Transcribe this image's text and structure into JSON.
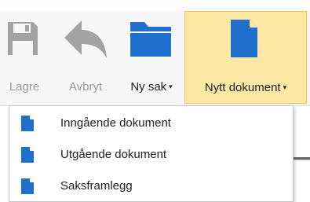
{
  "toolbar": {
    "buttons": [
      {
        "label": "Lagre",
        "icon": "floppy-disk-icon",
        "enabled": false
      },
      {
        "label": "Avbryt",
        "icon": "undo-arrow-icon",
        "enabled": false
      },
      {
        "label": "Ny sak",
        "icon": "folder-icon",
        "enabled": true,
        "has_dropdown": true
      },
      {
        "label": "Nytt dokument",
        "icon": "document-icon",
        "enabled": true,
        "has_dropdown": true,
        "active": true
      }
    ],
    "caret_glyph": "▾"
  },
  "dropdown": {
    "items": [
      {
        "label": "Inngående dokument",
        "icon": "document-icon"
      },
      {
        "label": "Utgående dokument",
        "icon": "document-icon"
      },
      {
        "label": "Saksframlegg",
        "icon": "document-icon"
      }
    ]
  },
  "colors": {
    "accent_blue": "#1f6fcc",
    "disabled_gray": "#a3a3a3",
    "active_button_fill": "#fde8a6",
    "active_button_border": "#f0c14b"
  }
}
